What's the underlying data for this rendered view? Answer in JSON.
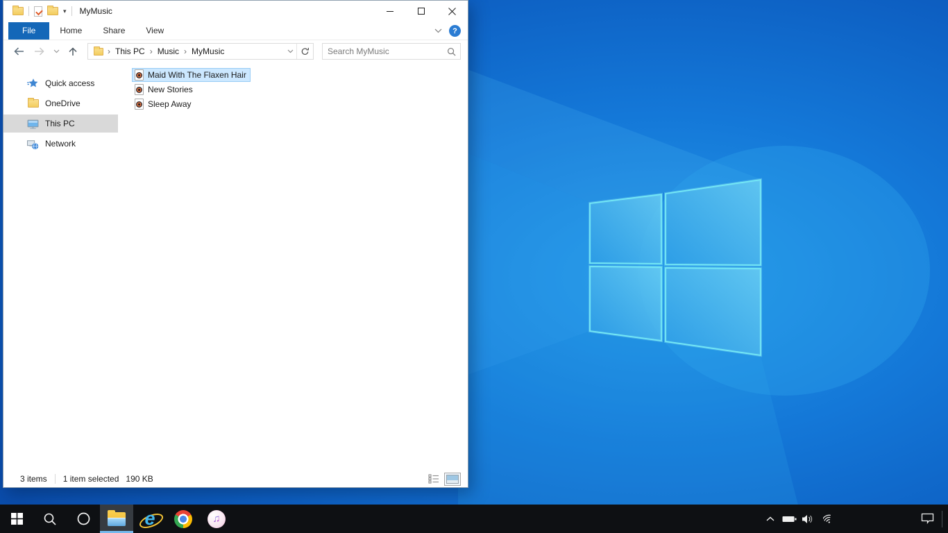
{
  "explorer": {
    "title": "MyMusic",
    "ribbon": {
      "tabs": [
        {
          "label": "File",
          "active": true
        },
        {
          "label": "Home",
          "active": false
        },
        {
          "label": "Share",
          "active": false
        },
        {
          "label": "View",
          "active": false
        }
      ]
    },
    "address": {
      "breadcrumb": [
        "This PC",
        "Music",
        "MyMusic"
      ]
    },
    "search": {
      "placeholder": "Search MyMusic"
    },
    "sidebar": {
      "items": [
        {
          "label": "Quick access",
          "icon": "quick-access-star",
          "selected": false
        },
        {
          "label": "OneDrive",
          "icon": "folder",
          "selected": false
        },
        {
          "label": "This PC",
          "icon": "computer",
          "selected": true
        },
        {
          "label": "Network",
          "icon": "network",
          "selected": false
        }
      ]
    },
    "files": [
      {
        "name": "Maid With The Flaxen Hair",
        "icon": "music-file",
        "selected": true
      },
      {
        "name": "New Stories",
        "icon": "music-file",
        "selected": false
      },
      {
        "name": "Sleep Away",
        "icon": "music-file",
        "selected": false
      }
    ],
    "status": {
      "count": "3 items",
      "selection": "1 item selected",
      "size": "190 KB"
    }
  },
  "icons": {
    "breadcrumb_separator": "›",
    "help": "?",
    "qat_menu_caret": "▾",
    "ie_letter": "e",
    "itunes_note": "♫"
  },
  "taskbar": {
    "items": [
      "start",
      "search",
      "cortana",
      "file-explorer",
      "internet-explorer",
      "chrome",
      "itunes"
    ],
    "active_item": "file-explorer",
    "tray": [
      "hidden-icons-chevron",
      "battery",
      "volume",
      "wifi",
      "action-center"
    ]
  },
  "colors": {
    "accent_tab": "#1467b8",
    "file_selection_bg": "#cce8ff",
    "file_selection_border": "#98ccf5",
    "sidebar_selection": "#d9d9d9",
    "taskbar_bg": "#0e1013",
    "taskbar_active_underline": "#76b9ed",
    "help_badge": "#2b7cd3",
    "folder_yellow": "#f6d56e",
    "desktop_base": "#1173d4",
    "logo_edge": "#74e9f5"
  }
}
